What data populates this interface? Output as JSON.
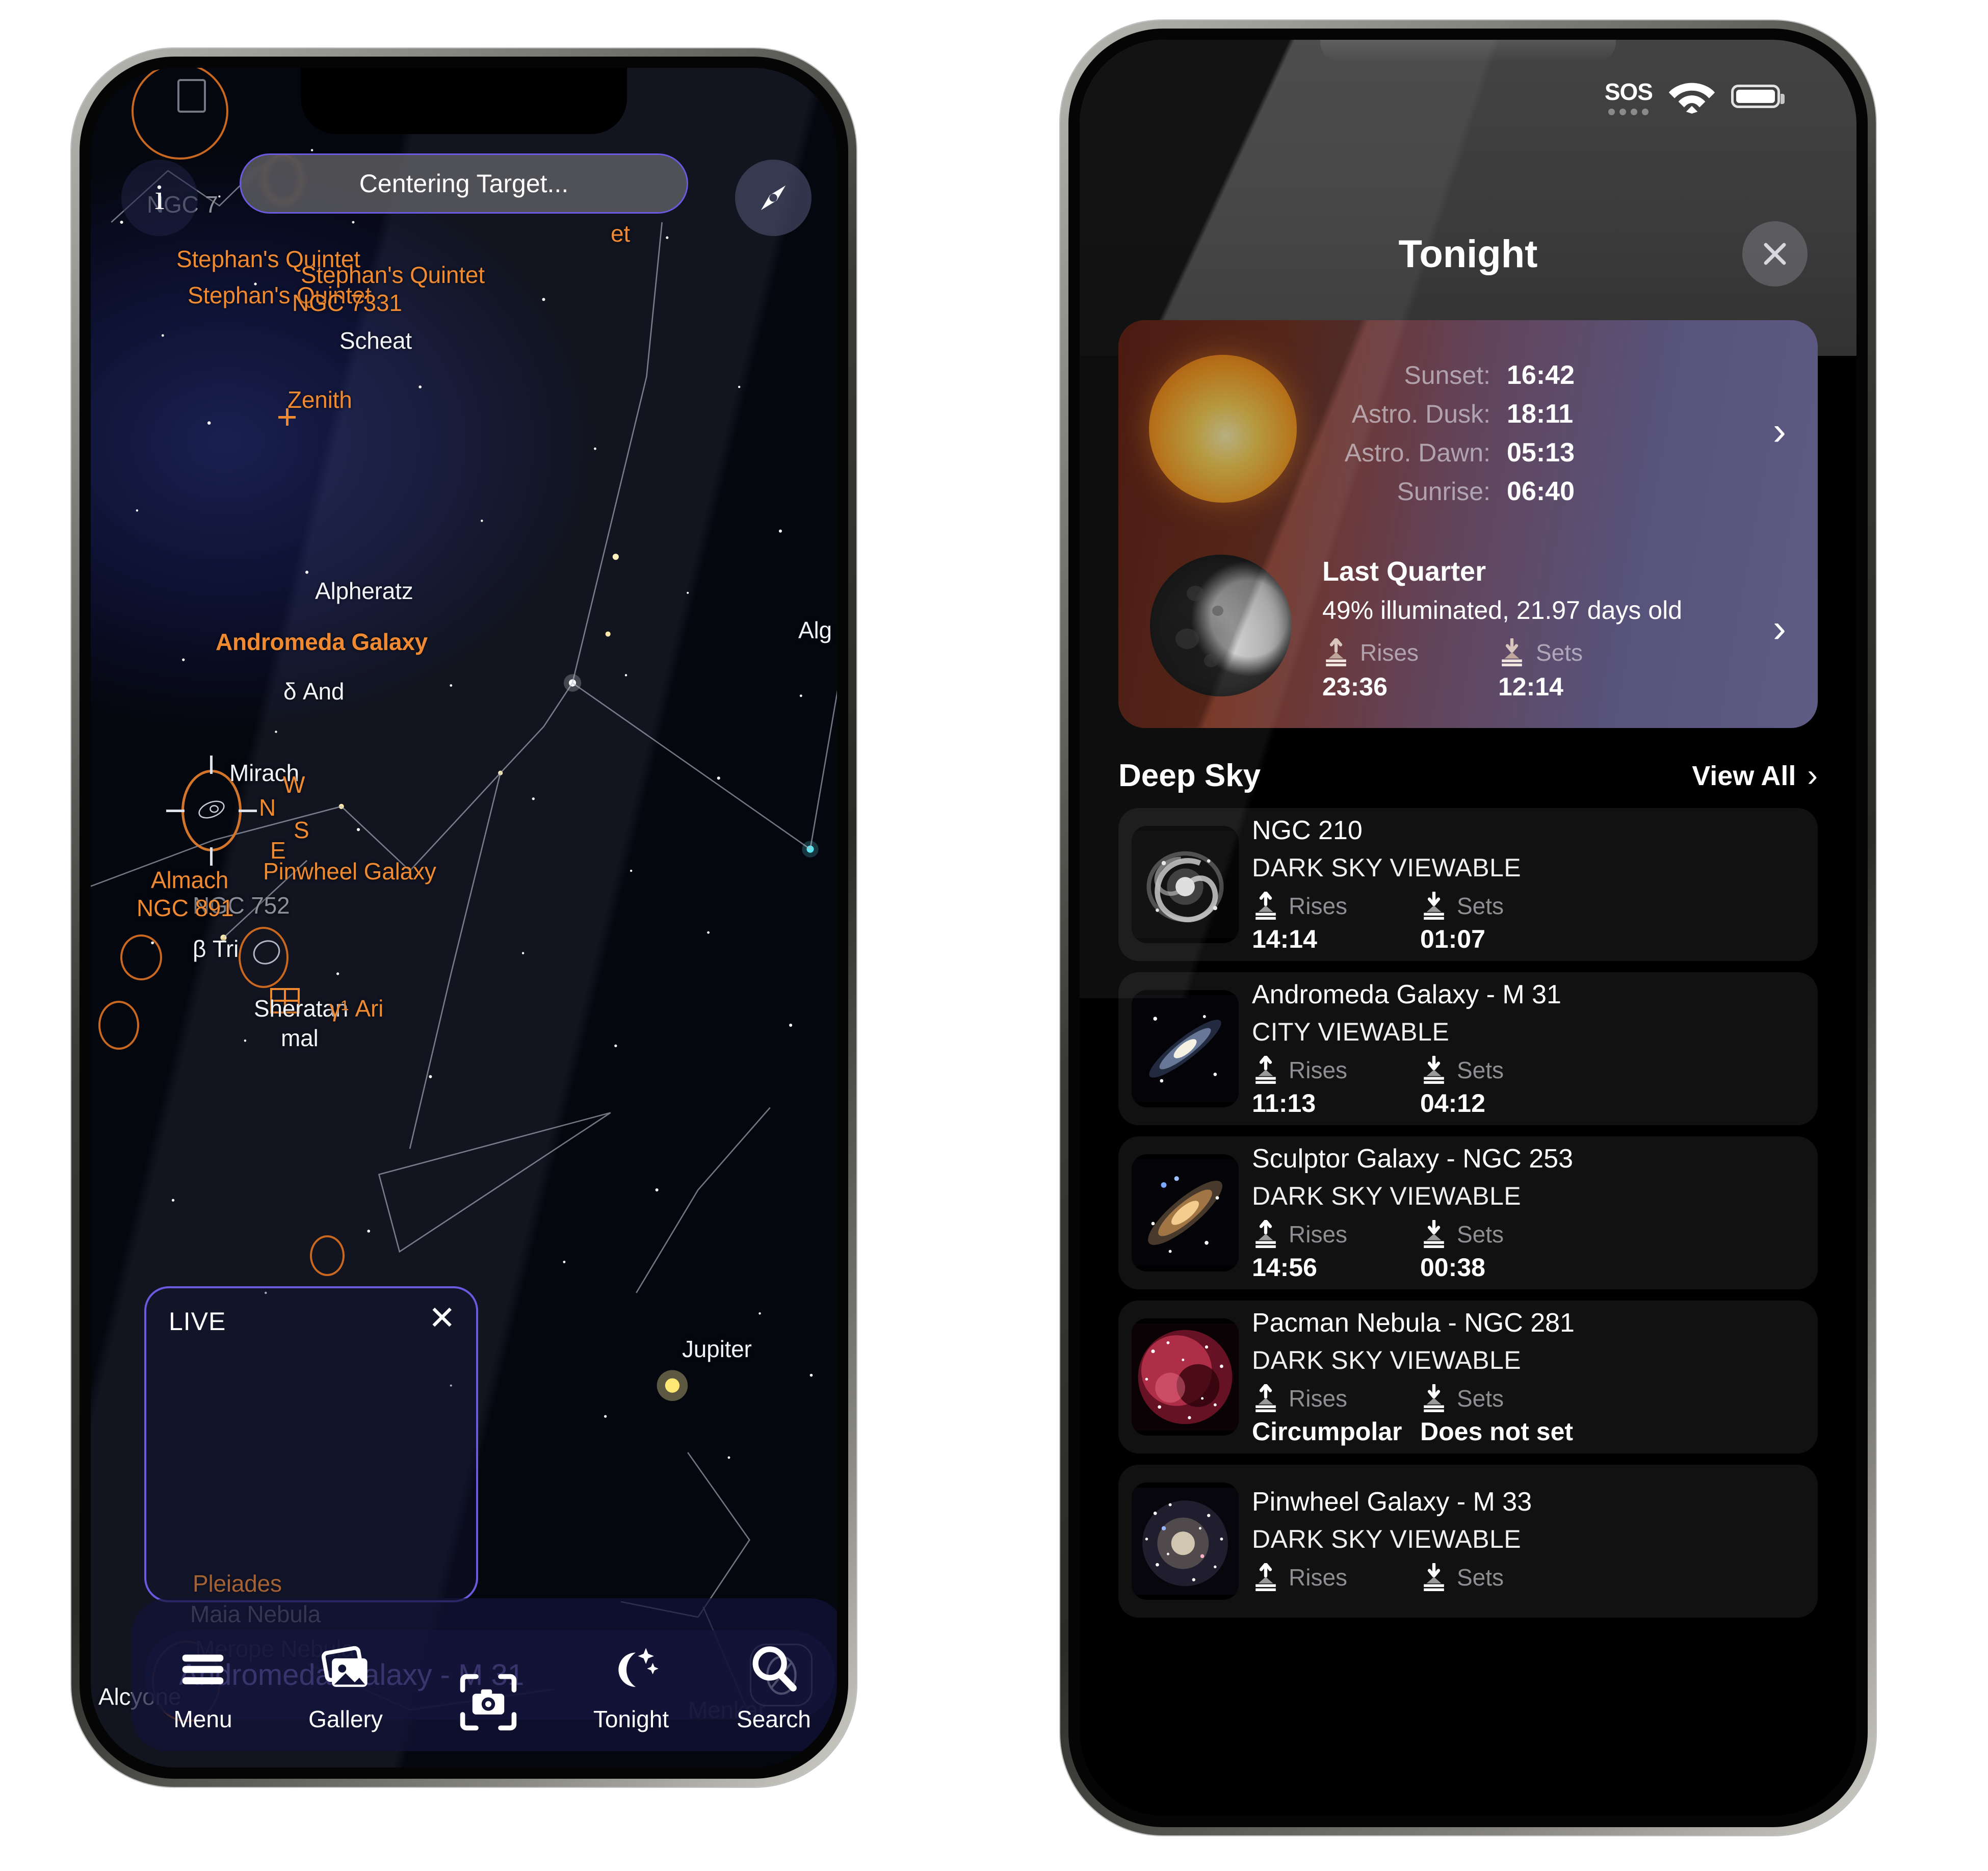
{
  "left_phone": {
    "toast": {
      "text": "Centering Target..."
    },
    "info_button": {
      "label": "i"
    },
    "compass_button": {
      "icon": "compass-needle-icon"
    },
    "live_panel": {
      "title": "LIVE",
      "close_icon": "close-icon"
    },
    "selection": {
      "name": "Andromeda Galaxy - M 31",
      "action_icon": "no-entry-icon"
    },
    "tabbar": [
      {
        "label": "Menu",
        "icon": "hamburger-menu-icon"
      },
      {
        "label": "Gallery",
        "icon": "photos-icon"
      },
      {
        "label": "",
        "icon": "camera-viewfinder-icon"
      },
      {
        "label": "Tonight",
        "icon": "moon-stars-icon"
      },
      {
        "label": "Search",
        "icon": "magnifier-icon"
      }
    ],
    "sky_labels": [
      {
        "text": "NGC 7",
        "kind": "dim"
      },
      {
        "text": "Stephan's Quintet",
        "kind": "orange"
      },
      {
        "text": "Stephan's Quintet",
        "kind": "orange"
      },
      {
        "text": "Stephan's Quintet",
        "kind": "orange"
      },
      {
        "text": "et",
        "kind": "orange"
      },
      {
        "text": "NGC 7331",
        "kind": "orange"
      },
      {
        "text": "Scheat",
        "kind": "white"
      },
      {
        "text": "Zenith",
        "kind": "orange"
      },
      {
        "text": "Alpheratz",
        "kind": "white"
      },
      {
        "text": "Andromeda Galaxy",
        "kind": "orange-bold"
      },
      {
        "text": "Alg",
        "kind": "white"
      },
      {
        "text": "δ And",
        "kind": "white"
      },
      {
        "text": "Mirach",
        "kind": "white"
      },
      {
        "text": "W",
        "kind": "orange"
      },
      {
        "text": "N",
        "kind": "orange"
      },
      {
        "text": "S",
        "kind": "orange"
      },
      {
        "text": "E",
        "kind": "orange"
      },
      {
        "text": "Pinwheel Galaxy",
        "kind": "orange"
      },
      {
        "text": "Almach",
        "kind": "orange"
      },
      {
        "text": "NGC 752",
        "kind": "dim"
      },
      {
        "text": "NGC 891",
        "kind": "orange"
      },
      {
        "text": "β Tri",
        "kind": "white"
      },
      {
        "text": "Sheratan",
        "kind": "white"
      },
      {
        "text": "mal",
        "kind": "white"
      },
      {
        "text": "γ¹ Ari",
        "kind": "orange"
      },
      {
        "text": "Jupiter",
        "kind": "white"
      },
      {
        "text": "Pleiades",
        "kind": "orange"
      },
      {
        "text": "Maia Nebula",
        "kind": "dim"
      },
      {
        "text": "Merope Nebula",
        "kind": "dim"
      },
      {
        "text": "Alcyone",
        "kind": "white"
      },
      {
        "text": "Menkar",
        "kind": "dim"
      }
    ]
  },
  "right_phone": {
    "status": {
      "carrier": "SOS",
      "wifi_icon": "wifi-icon",
      "battery_icon": "battery-icon"
    },
    "header": {
      "title": "Tonight",
      "close_icon": "close-icon"
    },
    "sun_card": {
      "sun_icon": "sun-icon",
      "rows": [
        {
          "label": "Sunset:",
          "value": "16:42"
        },
        {
          "label": "Astro. Dusk:",
          "value": "18:11"
        },
        {
          "label": "Astro. Dawn:",
          "value": "05:13"
        },
        {
          "label": "Sunrise:",
          "value": "06:40"
        }
      ],
      "chevron_icon": "chevron-right-icon"
    },
    "moon_card": {
      "moon_icon": "moon-icon",
      "phase": "Last Quarter",
      "detail": "49% illuminated, 21.97 days old",
      "rises_label": "Rises",
      "rises_value": "23:36",
      "sets_label": "Sets",
      "sets_value": "12:14",
      "chevron_icon": "chevron-right-icon"
    },
    "deep_sky": {
      "title": "Deep Sky",
      "view_all": "View All",
      "view_all_icon": "chevron-right-icon",
      "rises_label": "Rises",
      "sets_label": "Sets",
      "items": [
        {
          "name": "NGC 210",
          "viewability": "DARK SKY VIEWABLE",
          "rises": "14:14",
          "sets": "01:07",
          "thumb": "spiral-galaxy-grey"
        },
        {
          "name": "Andromeda Galaxy - M 31",
          "viewability": "CITY VIEWABLE",
          "rises": "11:13",
          "sets": "04:12",
          "thumb": "andromeda-edge-on"
        },
        {
          "name": "Sculptor Galaxy - NGC 253",
          "viewability": "DARK SKY VIEWABLE",
          "rises": "14:56",
          "sets": "00:38",
          "thumb": "sculptor-galaxy"
        },
        {
          "name": "Pacman Nebula - NGC 281",
          "viewability": "DARK SKY VIEWABLE",
          "rises": "Circumpolar",
          "sets": "Does not set",
          "thumb": "pacman-nebula-red"
        },
        {
          "name": "Pinwheel Galaxy - M 33",
          "viewability": "DARK SKY VIEWABLE",
          "rises": "",
          "sets": "",
          "thumb": "pinwheel-galaxy"
        }
      ]
    }
  },
  "colors": {
    "accent_orange": "#f08a32",
    "accent_purple": "#6a5ae0",
    "selection_text": "#9d8cf5",
    "dso_circle": "#c9681e",
    "card_bg": "#111111"
  }
}
